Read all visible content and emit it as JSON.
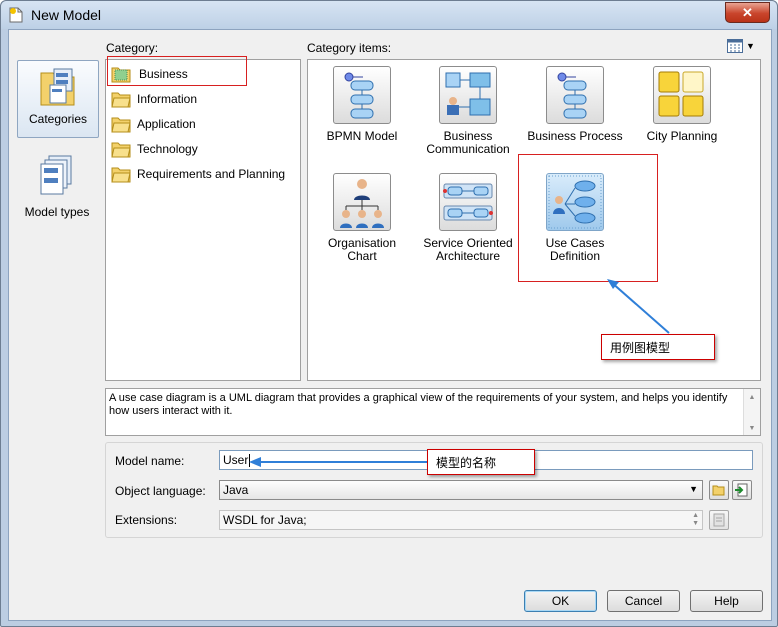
{
  "window": {
    "title": "New Model",
    "close_glyph": "✕"
  },
  "leftnav": {
    "items": [
      {
        "label": "Categories",
        "icon": "categories-icon",
        "selected": true
      },
      {
        "label": "Model types",
        "icon": "model-types-icon",
        "selected": false
      }
    ]
  },
  "category": {
    "label": "Category:",
    "items": [
      {
        "label": "Business",
        "icon": "business-folder-icon"
      },
      {
        "label": "Information",
        "icon": "folder-icon"
      },
      {
        "label": "Application",
        "icon": "folder-icon"
      },
      {
        "label": "Technology",
        "icon": "folder-icon"
      },
      {
        "label": "Requirements and Planning",
        "icon": "folder-icon"
      }
    ]
  },
  "category_items": {
    "label": "Category items:",
    "view_toggle_icon": "view-mode-icon",
    "items": [
      {
        "label": "BPMN Model",
        "icon": "bpmn-model-icon"
      },
      {
        "label": "Business Communication",
        "icon": "business-communication-icon"
      },
      {
        "label": "Business Process",
        "icon": "business-process-icon"
      },
      {
        "label": "City Planning",
        "icon": "city-planning-icon"
      },
      {
        "label": "Organisation Chart",
        "icon": "organisation-chart-icon"
      },
      {
        "label": "Service Oriented Architecture",
        "icon": "soa-icon"
      },
      {
        "label": "Use Cases Definition",
        "icon": "use-cases-icon"
      }
    ]
  },
  "description": "A use case diagram is a UML diagram that provides a graphical view of the requirements of your system, and helps you identify how users interact with it.",
  "form": {
    "model_name_label": "Model name:",
    "model_name_value": "User",
    "object_language_label": "Object language:",
    "object_language_value": "Java",
    "extensions_label": "Extensions:",
    "extensions_value": "WSDL for Java;"
  },
  "annotations": {
    "use_case_callout": "用例图模型",
    "model_name_callout": "模型的名称"
  },
  "buttons": {
    "ok": "OK",
    "cancel": "Cancel",
    "help": "Help"
  },
  "colors": {
    "annotation_red": "#d72020",
    "arrow_blue": "#2f7fd8",
    "selection_blue": "#3c7fb1"
  }
}
